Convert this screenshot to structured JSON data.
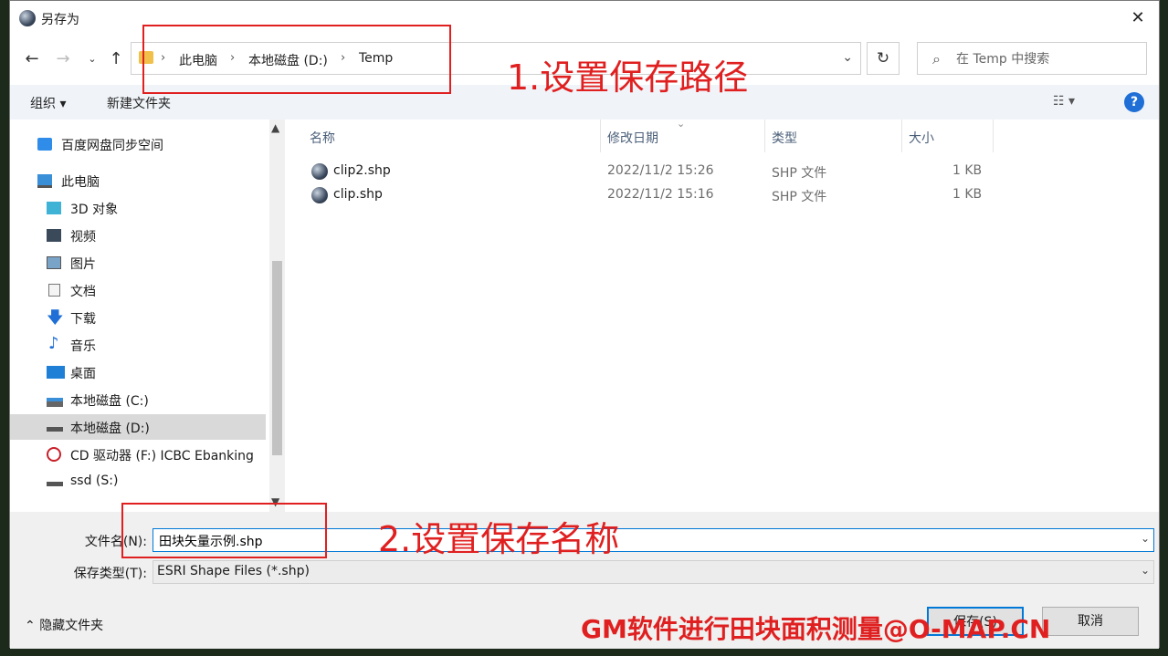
{
  "window": {
    "title": "另存为"
  },
  "address": {
    "crumbs": [
      "此电脑",
      "本地磁盘 (D:)",
      "Temp"
    ],
    "search_placeholder": "在 Temp 中搜索"
  },
  "toolbar": {
    "organize": "组织 ▾",
    "new_folder": "新建文件夹",
    "help": "?"
  },
  "sidebar": {
    "items": [
      {
        "label": "百度网盘同步空间"
      },
      {
        "label": "此电脑"
      },
      {
        "label": "3D 对象"
      },
      {
        "label": "视频"
      },
      {
        "label": "图片"
      },
      {
        "label": "文档"
      },
      {
        "label": "下载"
      },
      {
        "label": "音乐"
      },
      {
        "label": "桌面"
      },
      {
        "label": "本地磁盘 (C:)"
      },
      {
        "label": "本地磁盘 (D:)",
        "selected": true
      },
      {
        "label": "CD 驱动器 (F:) ICBC Ebanking"
      },
      {
        "label": "ssd (S:)"
      }
    ]
  },
  "columns": {
    "name": "名称",
    "date": "修改日期",
    "type": "类型",
    "size": "大小"
  },
  "files": [
    {
      "name": "clip2.shp",
      "date": "2022/11/2 15:26",
      "type": "SHP 文件",
      "size": "1 KB"
    },
    {
      "name": "clip.shp",
      "date": "2022/11/2 15:16",
      "type": "SHP 文件",
      "size": "1 KB"
    }
  ],
  "form": {
    "filename_label": "文件名(N):",
    "filename_value": "田块矢量示例.shp",
    "filetype_label": "保存类型(T):",
    "filetype_value": "ESRI Shape Files (*.shp)"
  },
  "footer": {
    "hide_folders": "隐藏文件夹",
    "save": "保存(S)",
    "cancel": "取消"
  },
  "annotations": {
    "step1": "1.设置保存路径",
    "step2": "2.设置保存名称",
    "watermark": "GM软件进行田块面积测量@O-MAP.CN",
    "color": "#e02020"
  },
  "colors": {
    "accent": "#0078d7",
    "selected_bg": "#d9d9d9"
  }
}
